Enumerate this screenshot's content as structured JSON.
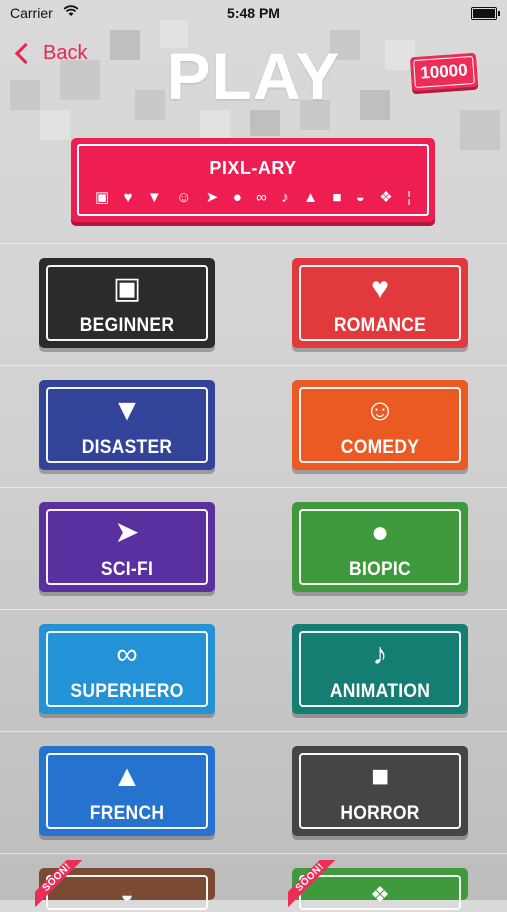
{
  "status_bar": {
    "carrier": "Carrier",
    "time": "5:48 PM"
  },
  "nav": {
    "back_label": "Back",
    "title": "PLAY",
    "coins": "10000"
  },
  "banner": {
    "title": "PIXL-ARY",
    "icons": [
      "film-icon",
      "heart-icon",
      "tornado-icon",
      "masks-icon",
      "raygun-icon",
      "person-icon",
      "mask-icon",
      "lamp-icon",
      "eiffel-tower-icon",
      "monster-icon",
      "hat-icon",
      "paw-icon",
      "oscar-icon"
    ]
  },
  "categories": [
    {
      "label": "BEGINNER",
      "icon": "film-icon",
      "color": "#2b2b2b"
    },
    {
      "label": "ROMANCE",
      "icon": "heart-icon",
      "color": "#e23a3c"
    },
    {
      "label": "DISASTER",
      "icon": "tornado-icon",
      "color": "#33439a"
    },
    {
      "label": "COMEDY",
      "icon": "masks-icon",
      "color": "#ea5a22"
    },
    {
      "label": "SCI-FI",
      "icon": "raygun-icon",
      "color": "#5a2f9f"
    },
    {
      "label": "BIOPIC",
      "icon": "person-icon",
      "color": "#3f9a3e"
    },
    {
      "label": "SUPERHERO",
      "icon": "mask-icon",
      "color": "#2392d6"
    },
    {
      "label": "ANIMATION",
      "icon": "lamp-icon",
      "color": "#147e73"
    },
    {
      "label": "FRENCH",
      "icon": "eiffel-tower-icon",
      "color": "#2573cf"
    },
    {
      "label": "HORROR",
      "icon": "monster-icon",
      "color": "#454545"
    }
  ],
  "coming_soon": [
    {
      "badge": "SOON!",
      "icon": "hat-icon",
      "color": "#7a4b32"
    },
    {
      "badge": "SOON!",
      "icon": "paw-icon",
      "color": "#3f9a3e"
    }
  ]
}
